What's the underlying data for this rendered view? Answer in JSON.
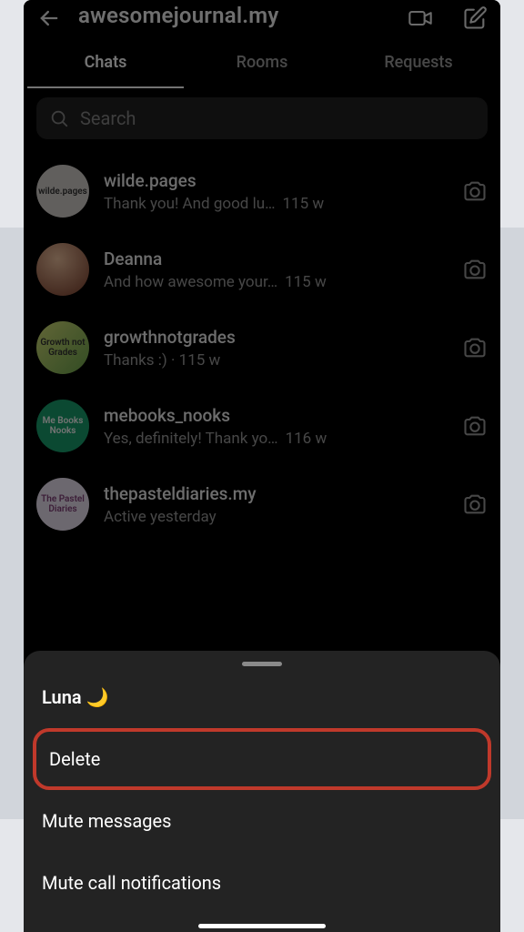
{
  "header": {
    "title": "awesomejournal.my"
  },
  "tabs": {
    "chats": "Chats",
    "rooms": "Rooms",
    "requests": "Requests"
  },
  "search": {
    "placeholder": "Search"
  },
  "chats": [
    {
      "avatar_text": "wilde.pages",
      "username": "wilde.pages",
      "preview": "Thank you! And good lu…",
      "time": "115 w"
    },
    {
      "avatar_text": "",
      "username": "Deanna",
      "preview": "And how awesome your…",
      "time": "115 w"
    },
    {
      "avatar_text": "Growth not Grades",
      "username": "growthnotgrades",
      "preview": "Thanks :) · 115 w",
      "time": ""
    },
    {
      "avatar_text": "Me Books Nooks",
      "username": "mebooks_nooks",
      "preview": "Yes, definitely! Thank yo…",
      "time": "116 w"
    },
    {
      "avatar_text": "The Pastel Diaries",
      "username": "thepasteldiaries.my",
      "preview": "Active yesterday",
      "time": ""
    }
  ],
  "sheet": {
    "title": "Luna 🌙",
    "delete": "Delete",
    "mute_messages": "Mute messages",
    "mute_calls": "Mute call notifications"
  }
}
